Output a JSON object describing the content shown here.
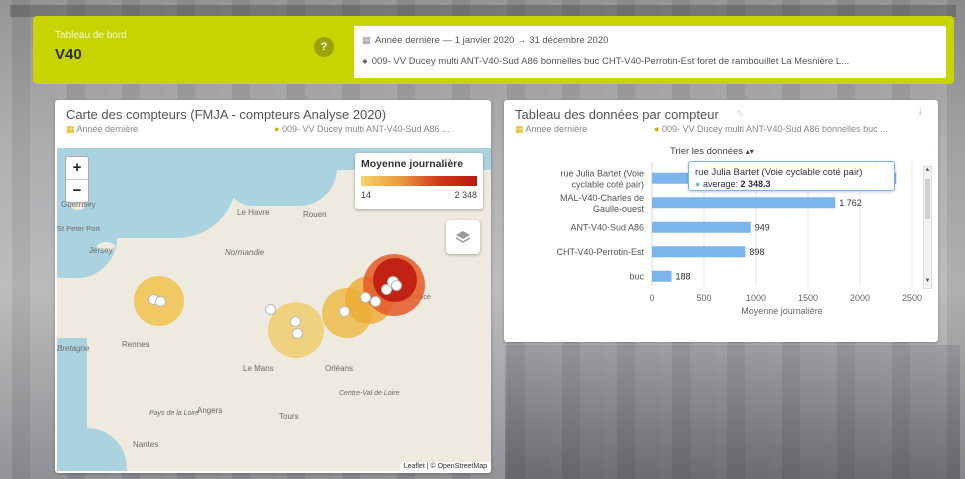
{
  "header": {
    "label": "Tableau de bord",
    "title": "V40",
    "help": "?",
    "period_line": "Année dernière  —  1 janvier 2020 → 31 décembre 2020",
    "site_line": "009- VV Ducey multi ANT-V40-Sud A86 bonnelles buc CHT-V40-Perrotin-Est foret de rambouillet La Mesnière L..."
  },
  "map_panel": {
    "title": "Carte des compteurs (FMJA - compteurs Analyse 2020)",
    "period": "Année dernière",
    "site": "009- VV Ducey multi ANT-V40-Sud A86 ...",
    "zoom_in": "+",
    "zoom_out": "−",
    "legend_title": "Moyenne journalière",
    "legend_min": "14",
    "legend_max": "2 348",
    "attribution": "Leaflet | © OpenStreetMap",
    "places": [
      "Guernsey",
      "St Peter Port",
      "Jersey",
      "Le Havre",
      "Rouen",
      "Normandie",
      "Rennes",
      "Bretagne",
      "Le Mans",
      "Orléans",
      "Centre-Val de Loire",
      "Angers",
      "Tours",
      "Pays de la Loire",
      "Nantes",
      "France"
    ]
  },
  "table_panel": {
    "title": "Tableau des données par compteur",
    "period": "Année dernière",
    "site": "009- VV Ducey multi ANT-V40-Sud A86 bonnelles buc ...",
    "sort_label": "Trier les données",
    "tooltip_title": "rue Julia Bartet (Voie cyclable coté pair)",
    "tooltip_series": "average:",
    "tooltip_value": "2 348.3"
  },
  "chart_data": {
    "type": "bar",
    "orientation": "horizontal",
    "categories": [
      "rue Julia Bartet (Voie cyclable coté pair)",
      "MAL-V40-Charles de Gaulle-ouest",
      "ANT-V40-Sud A86",
      "CHT-V40-Perrotin-Est",
      "buc"
    ],
    "series": [
      {
        "name": "average",
        "values": [
          2348.3,
          1762,
          949,
          898,
          188
        ]
      }
    ],
    "value_labels": [
      "",
      "1 762",
      "949",
      "898",
      "188"
    ],
    "xlabel": "Moyenne journalière",
    "ylabel": "",
    "xlim": [
      0,
      2500
    ],
    "ticks": [
      "0",
      "500",
      "1000",
      "1500",
      "2000",
      "2500"
    ],
    "colors": {
      "bar": "#7cb5ec"
    }
  }
}
